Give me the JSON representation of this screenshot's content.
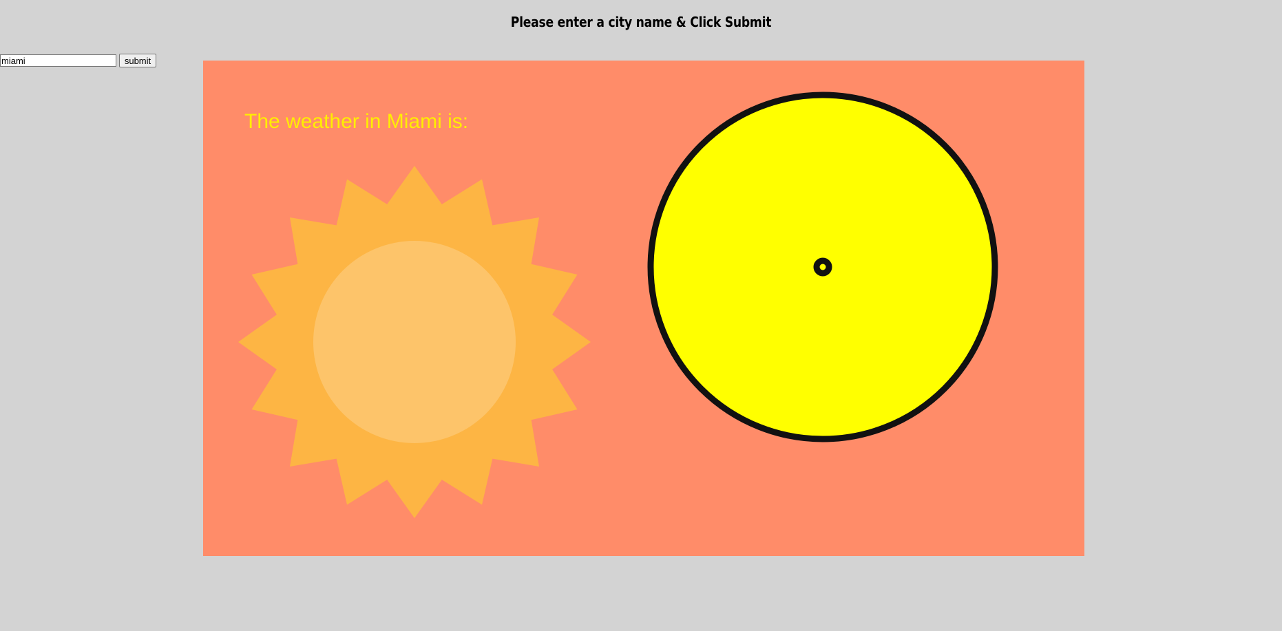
{
  "header": {
    "instructions": "Please enter a city name & Click Submit"
  },
  "form": {
    "city_value": "miami",
    "submit_label": "submit"
  },
  "weather": {
    "heading": "The weather in Miami is:",
    "condition_icon": "sun-icon",
    "gauge_icon": "yellow-dial-icon",
    "colors": {
      "page_background": "#d3d3d3",
      "panel_background": "#ff8c69",
      "sun_rays": "#fdb544",
      "sun_core": "#fdc46a",
      "heading_text": "#ffee00",
      "dial_fill": "#ffff00",
      "dial_outline": "#111111"
    }
  }
}
